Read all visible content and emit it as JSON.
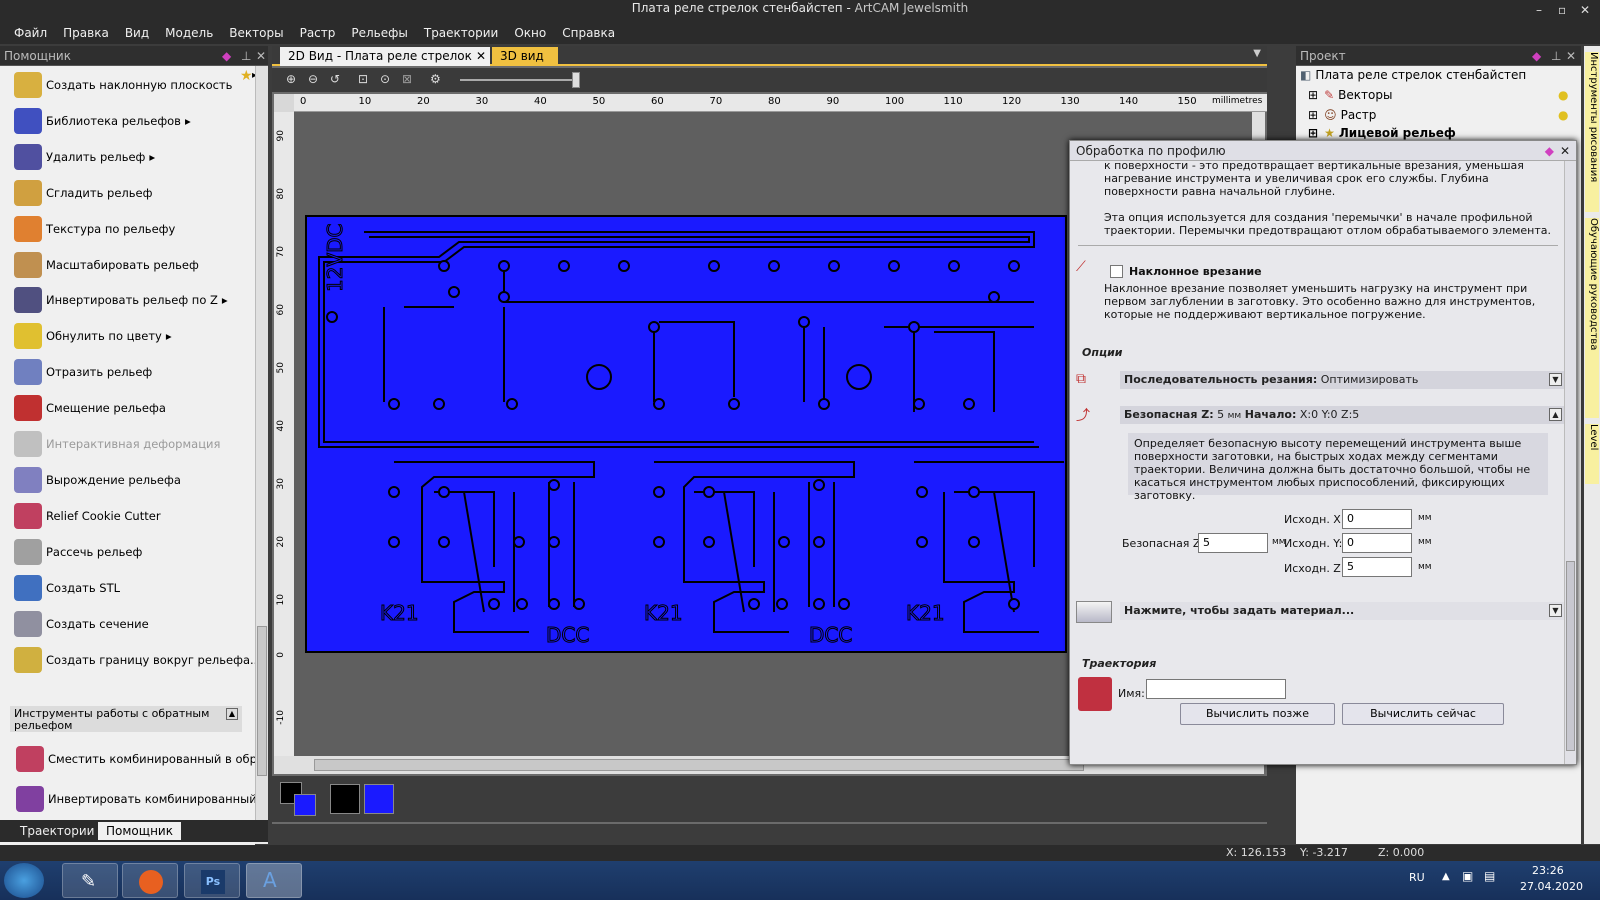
{
  "window": {
    "title": "Плата реле стрелок стенбайстеп",
    "app": "ArtCAM Jewelsmith"
  },
  "menu": [
    "Файл",
    "Правка",
    "Вид",
    "Модель",
    "Векторы",
    "Растр",
    "Рельефы",
    "Траектории",
    "Окно",
    "Справка"
  ],
  "assistant": {
    "title": "Помощник",
    "items": [
      {
        "label": "Создать наклонную плоскость",
        "arrow": "",
        "icon": "tilted-plane-icon",
        "color": "#d8b040"
      },
      {
        "label": "Библиотека рельефов",
        "arrow": "▸",
        "icon": "relief-library-icon",
        "color": "#4050c0"
      },
      {
        "label": "Удалить рельеф",
        "arrow": "▸",
        "icon": "delete-relief-icon",
        "color": "#5050a0"
      },
      {
        "label": "Сгладить рельеф",
        "arrow": "",
        "icon": "smooth-relief-icon",
        "color": "#d0a040"
      },
      {
        "label": "Текстура по рельефу",
        "arrow": "",
        "icon": "texture-relief-icon",
        "color": "#e08030"
      },
      {
        "label": "Масштабировать рельеф",
        "arrow": "",
        "icon": "scale-relief-icon",
        "color": "#c09050"
      },
      {
        "label": "Инвертировать рельеф по Z",
        "arrow": "▸",
        "icon": "invert-relief-icon",
        "color": "#505080"
      },
      {
        "label": "Обнулить по цвету",
        "arrow": "▸",
        "icon": "zero-by-color-icon",
        "color": "#e0c030"
      },
      {
        "label": "Отразить рельеф",
        "arrow": "",
        "icon": "mirror-relief-icon",
        "color": "#7080c0"
      },
      {
        "label": "Смещение рельефа",
        "arrow": "",
        "icon": "offset-relief-icon",
        "color": "#c03030"
      },
      {
        "label": "Интерактивная деформация",
        "arrow": "",
        "icon": "interactive-deform-icon",
        "color": "#c0c0c0"
      },
      {
        "label": "Вырождение рельефа",
        "arrow": "",
        "icon": "fade-relief-icon",
        "color": "#8080c0"
      },
      {
        "label": "Relief Cookie Cutter",
        "arrow": "",
        "icon": "cookie-cutter-icon",
        "color": "#c04060"
      },
      {
        "label": "Рассечь рельеф",
        "arrow": "",
        "icon": "slice-relief-icon",
        "color": "#a0a0a0"
      },
      {
        "label": "Создать STL",
        "arrow": "",
        "icon": "stl-icon",
        "color": "#4070c0"
      },
      {
        "label": "Создать сечение",
        "arrow": "",
        "icon": "section-icon",
        "color": "#9090a0"
      },
      {
        "label": "Создать границу вокруг рельефа...",
        "arrow": "",
        "icon": "border-relief-icon",
        "color": "#d0b040"
      }
    ],
    "group_title": "Инструменты работы с обратным рельефом",
    "group_items": [
      "Сместить комбинированный в обратный",
      "Инвертировать комбинированный в обр."
    ]
  },
  "bottom_tabs": [
    "Траектории",
    "Помощник"
  ],
  "doc_tabs": [
    "2D Вид - Плата реле стрелок",
    "3D вид"
  ],
  "ruler": {
    "x_ticks": [
      "0",
      "10",
      "20",
      "30",
      "40",
      "50",
      "60",
      "70",
      "80",
      "90",
      "100",
      "110",
      "120",
      "130",
      "140",
      "150"
    ],
    "unit": "millimetres",
    "y_ticks": [
      "90",
      "80",
      "70",
      "60",
      "50",
      "40",
      "30",
      "20",
      "10",
      "0",
      "-10"
    ]
  },
  "pcb_labels": [
    "12VDC",
    "K21",
    "DCC",
    "K21",
    "DCC",
    "K21"
  ],
  "colors": {
    "pcb_blue": "#1a1aff",
    "trace": "#000000",
    "accent_tab": "#f0c040"
  },
  "project": {
    "title": "Проект",
    "root": "Плата реле стрелок стенбайстеп",
    "nodes": [
      "Векторы",
      "Растр",
      "Лицевой рельеф"
    ]
  },
  "dialog": {
    "title": "Обработка по профилю",
    "intro_text": "к поверхности - это предотвращает вертикальные врезания, уменьшая нагревание инструмента и увеличивая срок его службы. Глубина поверхности равна начальной глубине.",
    "bridge_text": "Эта опция используется для создания 'перемычки' в начале профильной траектории. Перемычки предотвращают отлом обрабатываемого элемента.",
    "ramp_label": "Наклонное врезание",
    "ramp_text": "Наклонное врезание позволяет уменьшить нагрузку на инструмент при первом заглублении в заготовку. Это особенно важно для инструментов, которые не поддерживают вертикальное погружение.",
    "options_header": "Опции",
    "sequence_label": "Последовательность резания:",
    "sequence_value": "Оптимизировать",
    "safez_label": "Безопасная Z:",
    "safez_value": "5",
    "safez_unit": "мм",
    "start_label": "Начало:",
    "start_value": "X:0 Y:0 Z:5",
    "safez_desc": "Определяет безопасную высоту перемещений инструмента выше поверхности заготовки, на быстрых ходах между сегментами траектории. Величина должна быть достаточно большой, чтобы не касаться инструментом любых приспособлений, фиксирующих заготовку.",
    "home_x_label": "Исходн. X:",
    "home_x": "0",
    "home_y_label": "Исходн. Y:",
    "home_y": "0",
    "home_z_label": "Исходн. Z:",
    "home_z": "5",
    "safe_z_field_label": "Безопасная Z:",
    "unit_mm": "мм",
    "material_label": "Нажмите, чтобы задать материал...",
    "toolpath_header": "Траектория",
    "name_label": "Имя:",
    "name_value": "",
    "btn_later": "Вычислить позже",
    "btn_now": "Вычислить сейчас"
  },
  "side_tabs": [
    "Инструменты рисования",
    "Обучающие руководства",
    "Level"
  ],
  "status": {
    "x": "X: 126.153",
    "y": "Y: -3.217",
    "z": "Z: 0.000"
  },
  "tray": {
    "lang": "RU",
    "time": "23:26",
    "date": "27.04.2020"
  }
}
